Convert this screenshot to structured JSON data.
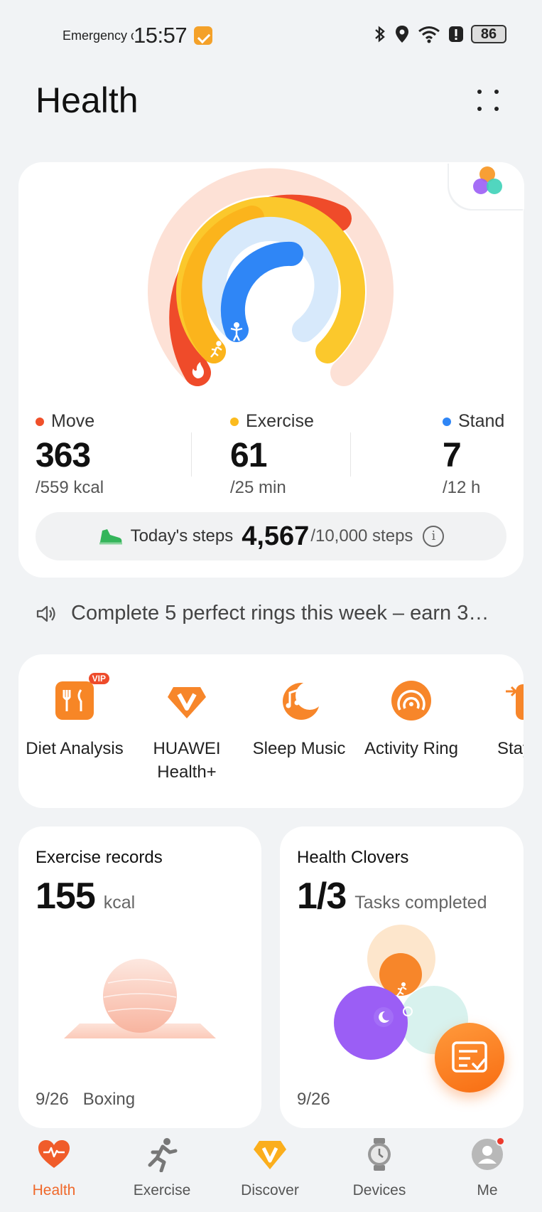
{
  "status_bar": {
    "carrier": "Emergency calls only",
    "time": "15:57",
    "battery": "86"
  },
  "header": {
    "title": "Health"
  },
  "rings": {
    "move": {
      "label": "Move",
      "value": "363",
      "goal": "/559 kcal",
      "progress": 0.65,
      "color": "#f0502a"
    },
    "exercise": {
      "label": "Exercise",
      "value": "61",
      "goal": "/25 min",
      "progress": 1.0,
      "color": "#fbbb1e"
    },
    "stand": {
      "label": "Stand",
      "value": "7",
      "goal": "/12 h",
      "progress": 0.58,
      "color": "#2f86f6"
    }
  },
  "steps": {
    "label": "Today's steps",
    "value": "4,567",
    "goal": "/10,000 steps"
  },
  "announcement": {
    "text": "Complete 5 perfect rings this week – earn 3…"
  },
  "services": [
    {
      "label": "Diet Analysis",
      "icon": "diet-icon",
      "badge": "VIP"
    },
    {
      "label": "HUAWEI Health+",
      "icon": "huawei-health-plus-icon"
    },
    {
      "label": "Sleep Music",
      "icon": "sleep-music-icon"
    },
    {
      "label": "Activity Ring",
      "icon": "activity-ring-icon"
    },
    {
      "label": "Stay Pla",
      "icon": "stay-plan-icon"
    }
  ],
  "exercise_records": {
    "title": "Exercise records",
    "value": "155",
    "unit": "kcal",
    "footer_date": "9/26",
    "footer_activity": "Boxing"
  },
  "health_clovers": {
    "title": "Health Clovers",
    "value": "1/3",
    "unit": "Tasks completed",
    "footer_date": "9/26"
  },
  "bottom_nav": [
    {
      "label": "Health",
      "icon": "heart-icon",
      "active": true
    },
    {
      "label": "Exercise",
      "icon": "running-icon"
    },
    {
      "label": "Discover",
      "icon": "discover-icon"
    },
    {
      "label": "Devices",
      "icon": "watch-icon"
    },
    {
      "label": "Me",
      "icon": "avatar-icon"
    }
  ],
  "colors": {
    "accent": "#f0682a",
    "move": "#f0502a",
    "exercise": "#fbbb1e",
    "stand": "#2f86f6"
  }
}
